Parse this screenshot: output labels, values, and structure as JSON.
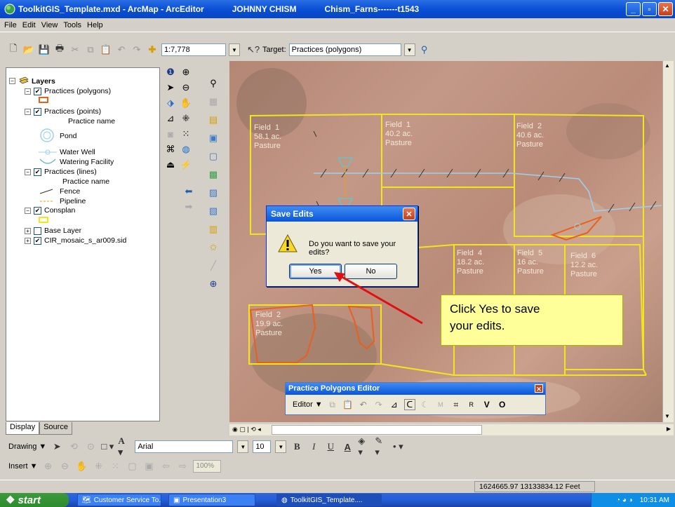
{
  "window": {
    "title_file": "ToolkitGIS_Template.mxd - ArcMap - ArcEditor",
    "title_user": "JOHNNY CHISM",
    "title_farm": "Chism_Farns-------t1543"
  },
  "menu": [
    "File",
    "Edit",
    "View",
    "Tools",
    "Help"
  ],
  "toolbar": {
    "scale": "1:7,778",
    "target_label": "Target:",
    "target_value": "Practices (polygons)"
  },
  "toc": {
    "root": "Layers",
    "items": [
      {
        "label": "Practices (polygons)"
      },
      {
        "label": "Practices (points)"
      },
      {
        "label": "Practice name"
      },
      {
        "label": "Pond"
      },
      {
        "label": "Water Well"
      },
      {
        "label": "Watering Facility"
      },
      {
        "label": "Practices (lines)"
      },
      {
        "label": "Practice name"
      },
      {
        "label": "Fence"
      },
      {
        "label": "Pipeline"
      },
      {
        "label": "Consplan"
      },
      {
        "label": "Base Layer"
      },
      {
        "label": "CIR_mosaic_s_ar009.sid"
      }
    ],
    "tabs": [
      "Display",
      "Source"
    ]
  },
  "map": {
    "fields": [
      {
        "name": "Field  1",
        "acres": "58.1 ac.",
        "use": "Pasture"
      },
      {
        "name": "Field  1",
        "acres": "40.2 ac.",
        "use": "Pasture"
      },
      {
        "name": "Field  2",
        "acres": "40.6 ac.",
        "use": "Pasture"
      },
      {
        "name": "Field  4",
        "acres": "18.2 ac.",
        "use": "Pasture"
      },
      {
        "name": "Field  5",
        "acres": "16 ac.",
        "use": "Pasture"
      },
      {
        "name": "Field  6",
        "acres": "12.2 ac.",
        "use": "Pasture"
      },
      {
        "name": "Field  2",
        "acres": "19.9 ac.",
        "use": "Pasture"
      }
    ]
  },
  "dialog": {
    "title": "Save Edits",
    "message": "Do you want to save your edits?",
    "yes": "Yes",
    "no": "No"
  },
  "callout": {
    "line1": "Click Yes to save",
    "line2": "your edits."
  },
  "editor": {
    "title": "Practice Polygons Editor",
    "menu": "Editor",
    "r": "R",
    "v": "V",
    "o": "O"
  },
  "drawing": {
    "label": "Drawing",
    "font": "Arial",
    "size": "10",
    "bold": "B",
    "italic": "I",
    "underline": "U",
    "a_label": "A"
  },
  "insert": {
    "label": "Insert",
    "zoom": "100%"
  },
  "status": {
    "coords": "1624665.97  13133834.12 Feet"
  },
  "taskbar": {
    "start": "start",
    "tasks": [
      "Customer Service To...",
      "Presentation3",
      "ToolkitGIS_Template...."
    ],
    "clock": "10:31 AM"
  }
}
